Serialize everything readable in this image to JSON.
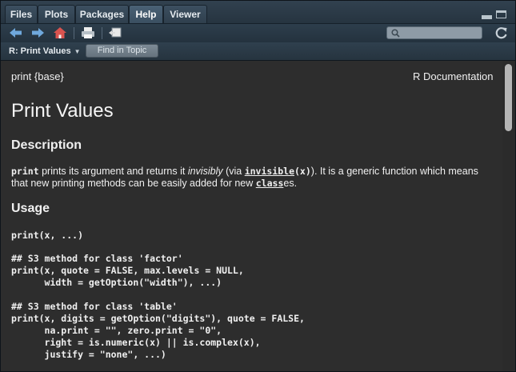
{
  "tabs": [
    {
      "label": "Files",
      "active": false
    },
    {
      "label": "Plots",
      "active": false
    },
    {
      "label": "Packages",
      "active": false
    },
    {
      "label": "Help",
      "active": true
    },
    {
      "label": "Viewer",
      "active": false
    }
  ],
  "toolbar": {
    "icons": [
      "back-arrow-icon",
      "forward-arrow-icon",
      "home-icon",
      "print-icon",
      "open-in-new-window-icon",
      "refresh-icon",
      "search-icon"
    ],
    "search_value": ""
  },
  "topicbar": {
    "breadcrumb": "R: Print Values",
    "find_button": "Find in Topic"
  },
  "doc": {
    "header_left": "print {base}",
    "header_right": "R Documentation",
    "title": "Print Values",
    "description_heading": "Description",
    "desc": {
      "code_print": "print",
      "t1": " prints its argument and returns it ",
      "t_em": "invisibly",
      "t2": " (via ",
      "link_invisible": "invisible",
      "code_x": "(x)",
      "t3": "). It is a generic function which means that new printing methods can be easily added for new ",
      "link_class": "class",
      "t4": "es."
    },
    "usage_heading": "Usage",
    "usage_code": [
      "print(x, ...)",
      "## S3 method for class 'factor'\nprint(x, quote = FALSE, max.levels = NULL,\n      width = getOption(\"width\"), ...)",
      "## S3 method for class 'table'\nprint(x, digits = getOption(\"digits\"), quote = FALSE,\n      na.print = \"\", zero.print = \"0\",\n      right = is.numeric(x) || is.complex(x),\n      justify = \"none\", ...)"
    ]
  },
  "colors": {
    "pane_bg": "#2d2d2d",
    "chrome": "#2a3945",
    "text": "#f0f0f0",
    "arrow_blue": "#6fa8dc",
    "home_red": "#d9534f"
  }
}
